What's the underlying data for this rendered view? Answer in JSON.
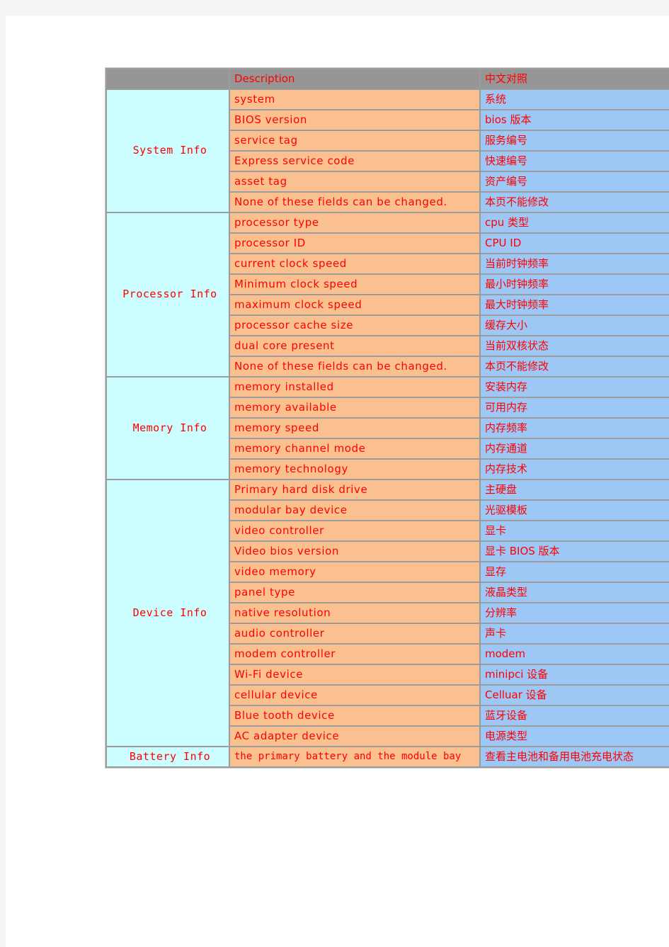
{
  "table": {
    "header": {
      "col_section": "",
      "col_description": "Description",
      "col_chinese": "中文对照"
    },
    "sections": [
      {
        "label": "System Info",
        "rows": [
          {
            "en": "system",
            "zh": "系统"
          },
          {
            "en": "BIOS version",
            "zh": "bios 版本"
          },
          {
            "en": "service tag",
            "zh": "服务编号"
          },
          {
            "en": "Express service code",
            "zh": "快速编号"
          },
          {
            "en": "asset tag",
            "zh": "资产编号"
          },
          {
            "en": "None of these fields can be changed.",
            "zh": "本页不能修改"
          }
        ]
      },
      {
        "label": "Processor Info",
        "rows": [
          {
            "en": "processor type",
            "zh": "cpu 类型"
          },
          {
            "en": "processor ID",
            "zh": "CPU ID"
          },
          {
            "en": "current clock speed",
            "zh": "当前时钟频率"
          },
          {
            "en": "Minimum clock speed",
            "zh": "最小时钟频率"
          },
          {
            "en": "maximum clock speed",
            "zh": "最大时钟频率"
          },
          {
            "en": "processor cache size",
            "zh": "缓存大小"
          },
          {
            "en": "dual core present",
            "zh": "当前双核状态"
          },
          {
            "en": "None of these fields can be changed.",
            "zh": "本页不能修改"
          }
        ]
      },
      {
        "label": "Memory Info",
        "rows": [
          {
            "en": "memory installed",
            "zh": "安装内存"
          },
          {
            "en": "memory available",
            "zh": "可用内存"
          },
          {
            "en": "memory speed",
            "zh": "内存频率"
          },
          {
            "en": "memory channel mode",
            "zh": "内存通道"
          },
          {
            "en": "memory technology",
            "zh": "内存技术"
          }
        ]
      },
      {
        "label": "Device Info",
        "rows": [
          {
            "en": "Primary hard disk drive",
            "zh": "主硬盘"
          },
          {
            "en": "modular bay device",
            "zh": "光驱模板"
          },
          {
            "en": "video controller",
            "zh": "显卡"
          },
          {
            "en": "Video bios version",
            "zh": "显卡 BIOS 版本"
          },
          {
            "en": "video memory",
            "zh": "显存"
          },
          {
            "en": "panel type",
            "zh": "液晶类型"
          },
          {
            "en": "native resolution",
            "zh": "分辨率"
          },
          {
            "en": "audio controller",
            "zh": "声卡"
          },
          {
            "en": "modem controller",
            "zh": "modem"
          },
          {
            "en": "Wi-Fi device",
            "zh": "minipci 设备"
          },
          {
            "en": "cellular device",
            "zh": "Celluar 设备"
          },
          {
            "en": "Blue tooth device",
            "zh": "蓝牙设备"
          },
          {
            "en": "AC adapter device",
            "zh": "电源类型"
          }
        ]
      },
      {
        "label": "Battery Info",
        "rows": [
          {
            "en": "the primary battery and the module bay",
            "zh": "查看主电池和备用电池充电状态"
          }
        ]
      }
    ]
  },
  "colors": {
    "header_bg": "#969696",
    "section_bg": "#ccfdff",
    "english_bg": "#fac090",
    "chinese_bg": "#9dc8f5",
    "text": "#ff0000",
    "grid": "#9c9c9c",
    "page_bg": "#ffffff",
    "canvas_bg": "#f4f4f4"
  }
}
